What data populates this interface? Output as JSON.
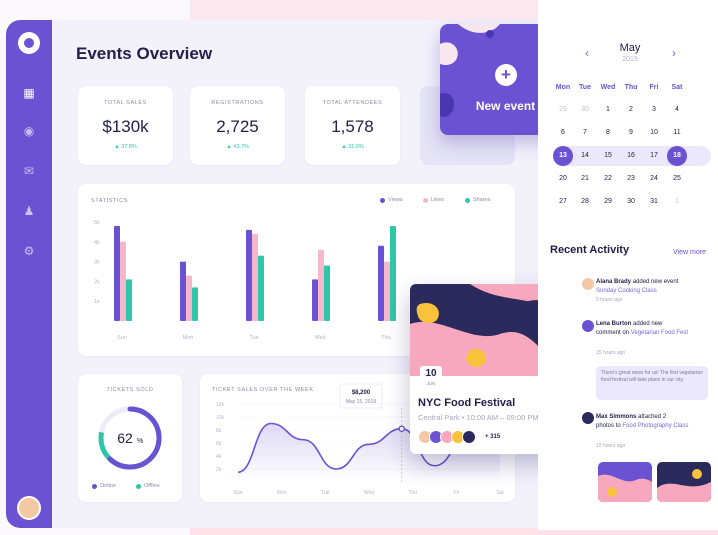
{
  "app": {
    "title": "Events Overview"
  },
  "sidebar": {
    "items": [
      {
        "icon": "dashboard-icon",
        "active": true
      },
      {
        "icon": "compass-icon",
        "active": false
      },
      {
        "icon": "inbox-icon",
        "active": false
      },
      {
        "icon": "user-icon",
        "active": false
      },
      {
        "icon": "settings-icon",
        "active": false
      }
    ]
  },
  "stats": [
    {
      "label": "TOTAL SALES",
      "value": "$130k",
      "change": "▲ 37.8%"
    },
    {
      "label": "REGISTRATIONS",
      "value": "2,725",
      "change": "▲ 43.7%"
    },
    {
      "label": "TOTAL ATTENDEES",
      "value": "1,578",
      "change": "▲ 31.6%"
    }
  ],
  "new_event": {
    "label": "New event",
    "button": "+"
  },
  "statistics": {
    "title": "STATISTICS",
    "legend": [
      "Views",
      "Likes",
      "Shares"
    ],
    "chart_data": {
      "type": "bar",
      "categories": [
        "Sun",
        "Mon",
        "Tue",
        "Wed",
        "Thu"
      ],
      "y_ticks": [
        "5k",
        "4k",
        "3k",
        "2k",
        "1k"
      ],
      "ylim": [
        0,
        5000
      ],
      "series": [
        {
          "name": "Views",
          "values": [
            4800,
            3000,
            4600,
            2100,
            3800
          ]
        },
        {
          "name": "Likes",
          "values": [
            4000,
            2300,
            4400,
            3600,
            3000
          ]
        },
        {
          "name": "Shares",
          "values": [
            2100,
            1700,
            3300,
            2800,
            4800
          ]
        }
      ]
    }
  },
  "tickets_sold": {
    "title": "TICKETS SOLD",
    "value": "62",
    "unit": "%",
    "percent": 62,
    "legend": [
      "Online",
      "Offline"
    ]
  },
  "ticket_sales_week": {
    "title": "TICKET SALES OVER THE WEEK",
    "tooltip_value": "$8,200",
    "tooltip_date": "May 15, 2019",
    "chart_data": {
      "type": "line",
      "x": [
        "Sun",
        "Mon",
        "Tue",
        "Wed",
        "Thu",
        "Fri",
        "Sat"
      ],
      "y_ticks": [
        "12k",
        "10k",
        "8k",
        "6k",
        "4k",
        "2k"
      ],
      "ylim": [
        0,
        12000
      ],
      "values": [
        1500,
        9000,
        6500,
        2000,
        5800,
        8200,
        2500,
        6500,
        8000
      ]
    }
  },
  "calendar": {
    "month": "May",
    "year": "2019",
    "prev": "‹",
    "next": "›",
    "weekdays": [
      "Mon",
      "Tue",
      "Wed",
      "Thu",
      "Fri",
      "Sat"
    ],
    "rows": [
      [
        "29",
        "30",
        "1",
        "2",
        "3",
        "4"
      ],
      [
        "6",
        "7",
        "8",
        "9",
        "10",
        "11"
      ],
      [
        "13",
        "14",
        "15",
        "16",
        "17",
        "18"
      ],
      [
        "20",
        "21",
        "22",
        "23",
        "24",
        "25"
      ],
      [
        "27",
        "28",
        "29",
        "30",
        "31",
        "1"
      ]
    ],
    "range_start": "13",
    "range_end": "18"
  },
  "recent_activity": {
    "title": "Recent Activity",
    "view_more": "View more",
    "items": [
      {
        "name": "Alana Brady",
        "action": "added new event",
        "target": "Sunday Cooking Class",
        "time": "5 hours ago"
      },
      {
        "name": "Lena Burton",
        "action": "added new",
        "action2": "comment on",
        "target": "Vegetarian Food Fest",
        "time": "15 hours ago"
      },
      {
        "name": "Max Simmons",
        "action": "attached 2",
        "action2": "photos to",
        "target": "Food Photography Class",
        "time": "19 hours ago"
      }
    ],
    "quote": "There's great news for us! The first vegetarian food festival will take place in our city."
  },
  "food_event": {
    "day": "10",
    "month": "JUN",
    "title": "NYC Food Festival",
    "location": "Central Park",
    "time": "10:00 AM – 09:00 PM",
    "attendees_more": "+ 315"
  },
  "colors": {
    "primary": "#6a52d3",
    "teal": "#2ec7a7",
    "pink": "#f6b7cd",
    "navy": "#23214a"
  }
}
